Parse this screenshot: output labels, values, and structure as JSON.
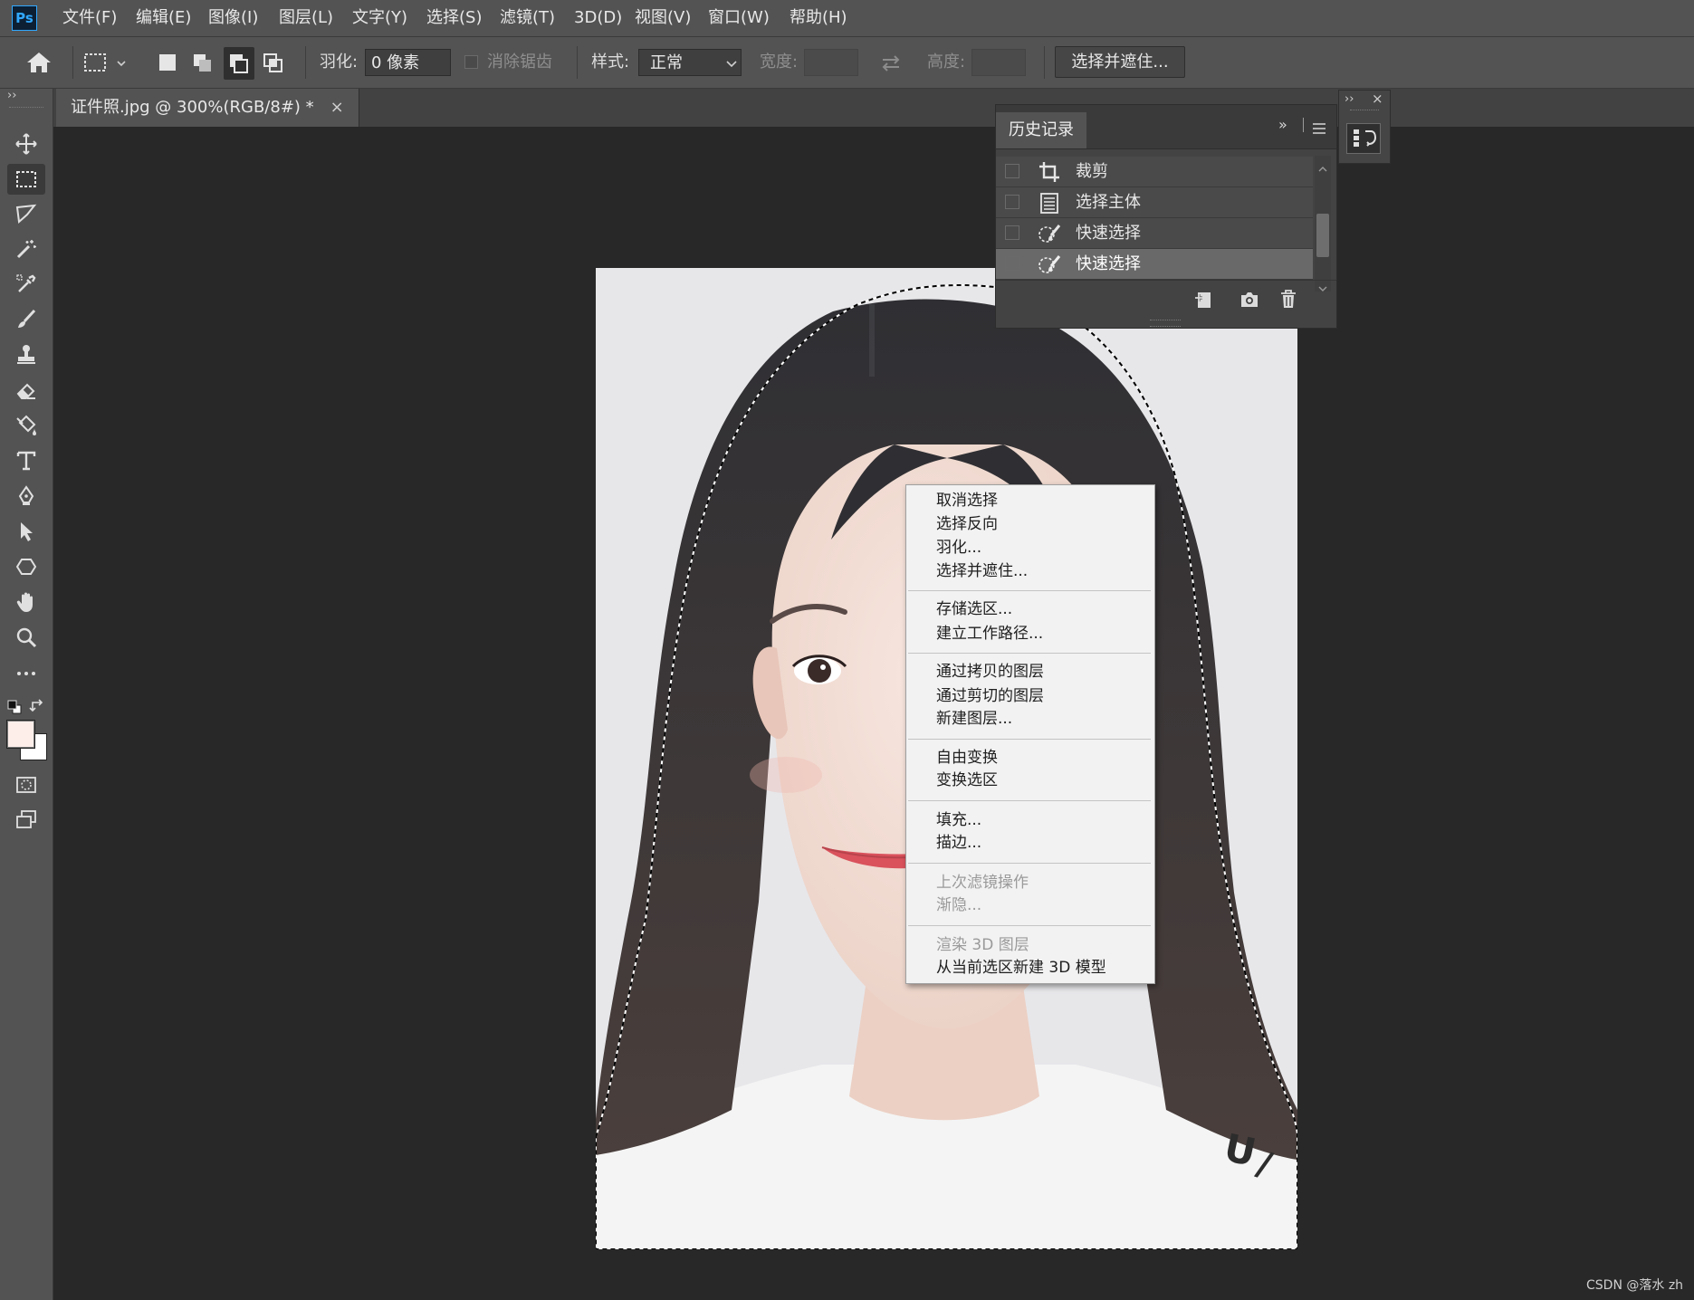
{
  "menubar": {
    "logo": "Ps",
    "items": [
      "文件(F)",
      "编辑(E)",
      "图像(I)",
      "图层(L)",
      "文字(Y)",
      "选择(S)",
      "滤镜(T)",
      "3D(D)",
      "视图(V)",
      "窗口(W)",
      "帮助(H)"
    ]
  },
  "options": {
    "feather_label": "羽化:",
    "feather_value": "0 像素",
    "antialias_label": "消除锯齿",
    "style_label": "样式:",
    "style_value": "正常",
    "width_label": "宽度:",
    "height_label": "高度:",
    "select_mask_button": "选择并遮住..."
  },
  "document": {
    "tab_title": "证件照.jpg @ 300%(RGB/8#) *",
    "close": "×"
  },
  "history": {
    "title": "历史记录",
    "items": [
      {
        "icon": "crop-icon",
        "label": "裁剪",
        "selected": false
      },
      {
        "icon": "document-icon",
        "label": "选择主体",
        "selected": false
      },
      {
        "icon": "quick-selection-icon",
        "label": "快速选择",
        "selected": false
      },
      {
        "icon": "quick-selection-icon",
        "label": "快速选择",
        "selected": true
      }
    ]
  },
  "context_menu": {
    "groups": [
      [
        {
          "label": "取消选择",
          "enabled": true
        },
        {
          "label": "选择反向",
          "enabled": true
        },
        {
          "label": "羽化...",
          "enabled": true
        },
        {
          "label": "选择并遮住...",
          "enabled": true
        }
      ],
      [
        {
          "label": "存储选区...",
          "enabled": true
        },
        {
          "label": "建立工作路径...",
          "enabled": true
        }
      ],
      [
        {
          "label": "通过拷贝的图层",
          "enabled": true
        },
        {
          "label": "通过剪切的图层",
          "enabled": true
        },
        {
          "label": "新建图层...",
          "enabled": true
        }
      ],
      [
        {
          "label": "自由变换",
          "enabled": true
        },
        {
          "label": "变换选区",
          "enabled": true
        }
      ],
      [
        {
          "label": "填充...",
          "enabled": true
        },
        {
          "label": "描边...",
          "enabled": true
        }
      ],
      [
        {
          "label": "上次滤镜操作",
          "enabled": false
        },
        {
          "label": "渐隐...",
          "enabled": false
        }
      ],
      [
        {
          "label": "渲染 3D 图层",
          "enabled": false
        },
        {
          "label": "从当前选区新建 3D 模型",
          "enabled": true
        }
      ]
    ]
  },
  "colors": {
    "foreground": "#fdeeea",
    "background": "#ffffff",
    "accent": "#31a8ff"
  },
  "watermark": "CSDN @落水 zh"
}
